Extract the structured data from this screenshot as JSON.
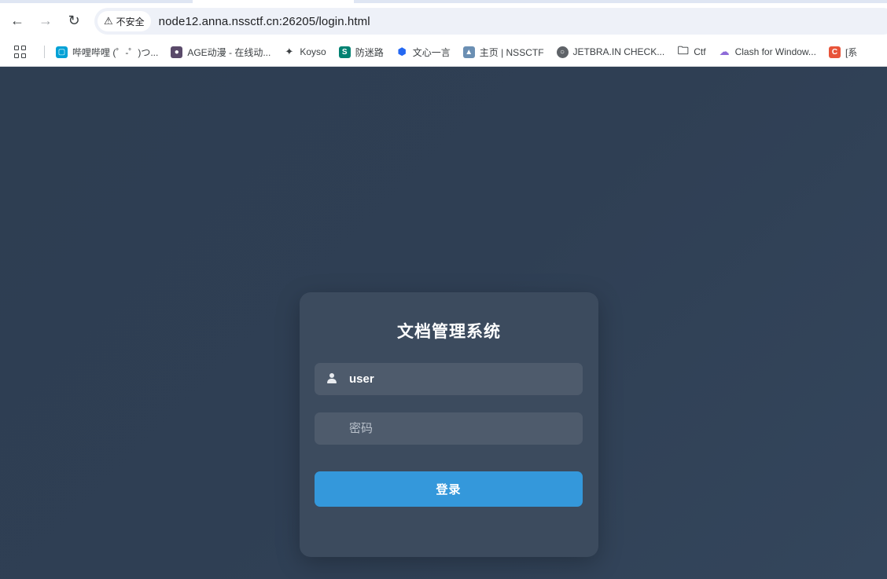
{
  "browser": {
    "back_icon": "arrow-left-icon",
    "forward_icon": "arrow-right-icon",
    "reload_icon": "reload-icon",
    "security_label": "不安全",
    "url": "node12.anna.nssctf.cn:26205/login.html"
  },
  "bookmarks": [
    {
      "label": "哔哩哔哩 (゜-゜)つ...",
      "icon": "bilibili-icon",
      "color": "#00a1d6"
    },
    {
      "label": "AGE动漫 - 在线动...",
      "icon": "age-anime-icon",
      "color": "#5a4a6a"
    },
    {
      "label": "Koyso",
      "icon": "sparkle-icon",
      "color": "#3c4043"
    },
    {
      "label": "防迷路",
      "icon": "sway-icon",
      "color": "#008272"
    },
    {
      "label": "文心一言",
      "icon": "wenxin-icon",
      "color": "#2468f2"
    },
    {
      "label": "主页 | NSSCTF",
      "icon": "nssctf-icon",
      "color": "#6b8fb3"
    },
    {
      "label": "JETBRA.IN CHECK...",
      "icon": "globe-icon",
      "color": "#3c4043"
    },
    {
      "label": "Ctf",
      "icon": "folder-icon",
      "color": "#3c4043"
    },
    {
      "label": "Clash for Window...",
      "icon": "cloud-icon",
      "color": "#8e6bd8"
    },
    {
      "label": "[系",
      "icon": "c-icon",
      "color": "#e8543a"
    }
  ],
  "login": {
    "title": "文档管理系统",
    "username_value": "user",
    "password_placeholder": "密码",
    "submit_label": "登录"
  },
  "colors": {
    "page_background": "#2f3f54",
    "card_background": "#3c4b5e",
    "input_background": "#4e5b6c",
    "button_accent": "#3498db"
  }
}
